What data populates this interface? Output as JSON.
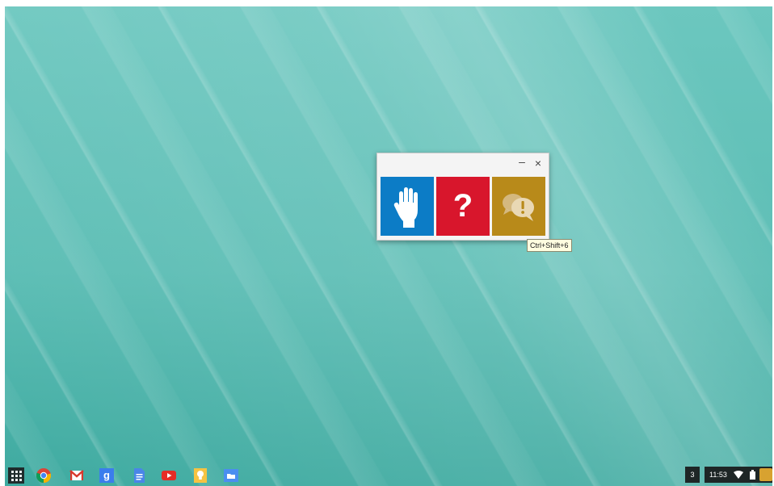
{
  "window": {
    "minimize_label": "–",
    "close_label": "×",
    "tiles": [
      {
        "name": "raise-hand",
        "icon": "raise-hand-icon",
        "color": "#0c7cc6"
      },
      {
        "name": "help",
        "icon": "question-mark-icon",
        "label": "?",
        "color": "#d8162c"
      },
      {
        "name": "chat",
        "icon": "chat-alert-icon",
        "color": "#b88a1a"
      }
    ]
  },
  "tooltip": {
    "text": "Ctrl+Shift+6"
  },
  "shelf": {
    "apps": [
      {
        "name": "launcher",
        "icon": "app-launcher-icon"
      },
      {
        "name": "chrome",
        "icon": "chrome-icon"
      },
      {
        "name": "gmail",
        "icon": "gmail-icon"
      },
      {
        "name": "google-search",
        "icon": "google-search-icon",
        "label": "g"
      },
      {
        "name": "docs",
        "icon": "docs-icon"
      },
      {
        "name": "youtube",
        "icon": "youtube-icon"
      },
      {
        "name": "keep",
        "icon": "keep-lightbulb-icon"
      },
      {
        "name": "files",
        "icon": "files-icon"
      }
    ],
    "status": {
      "notification_count": "3",
      "time": "11:53"
    }
  },
  "colors": {
    "desktop_bg": "#5bbdb4",
    "shelf_bg": "#1e2626"
  }
}
